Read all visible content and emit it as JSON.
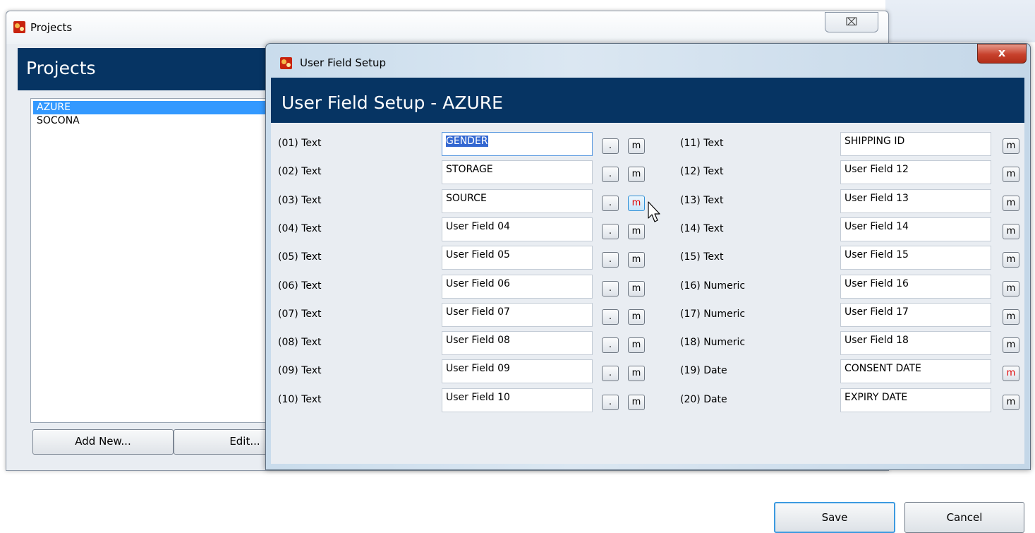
{
  "projects_window": {
    "title": "Projects",
    "close_glyph": "⌧",
    "header": "Projects",
    "projects": [
      "AZURE",
      "SOCONA"
    ],
    "selected_index": 0,
    "add_new_label": "Add New...",
    "edit_label": "Edit..."
  },
  "dialog": {
    "title": "User Field Setup",
    "close_glyph": "x",
    "header": "User Field Setup - AZURE",
    "left_fields": [
      {
        "label": "(01)  Text",
        "value": "GENDER",
        "has_dot": true,
        "m_red": false
      },
      {
        "label": "(02)  Text",
        "value": "STORAGE",
        "has_dot": true,
        "m_red": false
      },
      {
        "label": "(03)  Text",
        "value": "SOURCE",
        "has_dot": true,
        "m_red": true
      },
      {
        "label": "(04)  Text",
        "value": "User Field 04",
        "has_dot": true,
        "m_red": false
      },
      {
        "label": "(05)  Text",
        "value": "User Field 05",
        "has_dot": true,
        "m_red": false
      },
      {
        "label": "(06)  Text",
        "value": "User Field 06",
        "has_dot": true,
        "m_red": false
      },
      {
        "label": "(07)  Text",
        "value": "User Field 07",
        "has_dot": true,
        "m_red": false
      },
      {
        "label": "(08)  Text",
        "value": "User Field 08",
        "has_dot": true,
        "m_red": false
      },
      {
        "label": "(09)  Text",
        "value": "User Field 09",
        "has_dot": true,
        "m_red": false
      },
      {
        "label": "(10)  Text",
        "value": "User Field 10",
        "has_dot": true,
        "m_red": false
      }
    ],
    "right_fields": [
      {
        "label": "(11)  Text",
        "value": "SHIPPING ID",
        "m_red": false
      },
      {
        "label": "(12)  Text",
        "value": "User Field 12",
        "m_red": false
      },
      {
        "label": "(13)  Text",
        "value": "User Field 13",
        "m_red": false
      },
      {
        "label": "(14)  Text",
        "value": "User Field 14",
        "m_red": false
      },
      {
        "label": "(15)  Text",
        "value": "User Field 15",
        "m_red": false
      },
      {
        "label": "(16)  Numeric",
        "value": "User Field 16",
        "m_red": false
      },
      {
        "label": "(17)  Numeric",
        "value": "User Field 17",
        "m_red": false
      },
      {
        "label": "(18)  Numeric",
        "value": "User Field 18",
        "m_red": false
      },
      {
        "label": "(19)  Date",
        "value": "CONSENT DATE",
        "m_red": true
      },
      {
        "label": "(20)  Date",
        "value": "EXPIRY DATE",
        "m_red": false
      }
    ],
    "dot_label": ".",
    "m_label": "m",
    "save_label": "Save",
    "cancel_label": "Cancel"
  },
  "colors": {
    "header_bg": "#063463",
    "selection": "#3399ff",
    "modified_marker": "#e00000"
  }
}
